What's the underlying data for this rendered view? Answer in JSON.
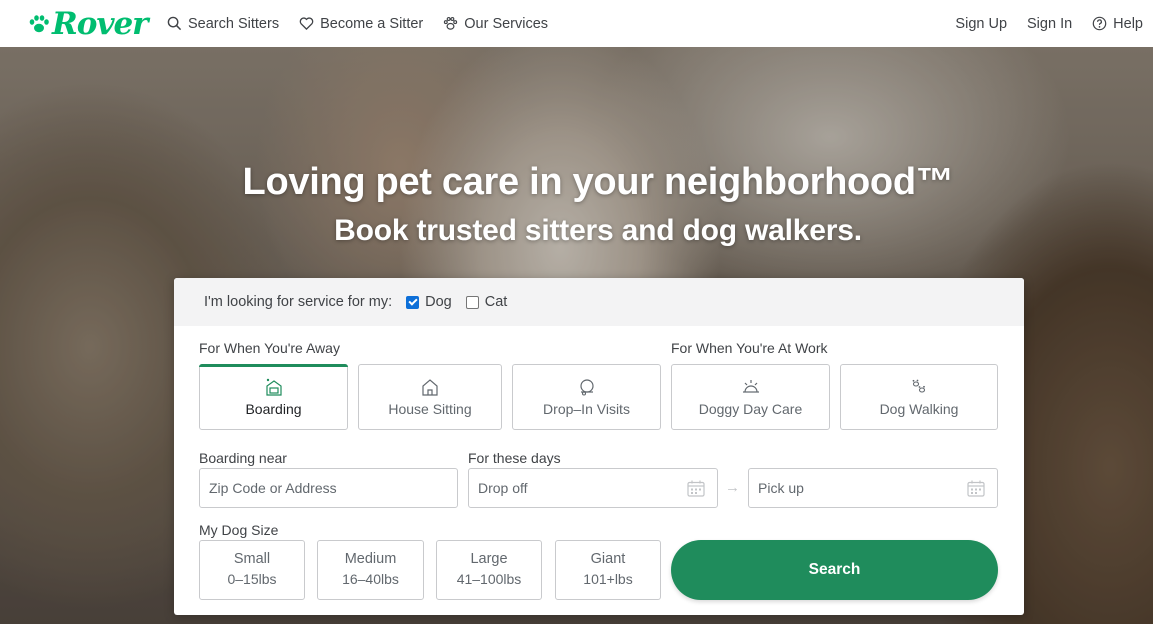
{
  "brand": {
    "name": "Rover",
    "color": "#00bd70",
    "accent": "#1f8c5c"
  },
  "nav": {
    "left": [
      {
        "label": "Search Sitters",
        "icon": "search-icon"
      },
      {
        "label": "Become a Sitter",
        "icon": "heart-icon"
      },
      {
        "label": "Our Services",
        "icon": "paw-icon"
      }
    ],
    "right": [
      {
        "label": "Sign Up"
      },
      {
        "label": "Sign In"
      },
      {
        "label": "Help",
        "icon": "help-icon"
      }
    ]
  },
  "hero": {
    "title": "Loving pet care in your neighborhood™",
    "subtitle": "Book trusted sitters and dog walkers."
  },
  "search": {
    "pet_prompt": "I'm looking for service for my:",
    "pets": [
      {
        "label": "Dog",
        "checked": true
      },
      {
        "label": "Cat",
        "checked": false
      }
    ],
    "away_label": "For When You're Away",
    "work_label": "For When You're At Work",
    "services": [
      {
        "label": "Boarding",
        "icon": "boarding-icon",
        "active": true
      },
      {
        "label": "House Sitting",
        "icon": "house-sitting-icon",
        "active": false
      },
      {
        "label": "Drop–In Visits",
        "icon": "drop-in-icon",
        "active": false
      },
      {
        "label": "Doggy Day Care",
        "icon": "day-care-icon",
        "active": false
      },
      {
        "label": "Dog Walking",
        "icon": "dog-walking-icon",
        "active": false
      }
    ],
    "location_label": "Boarding near",
    "location_placeholder": "Zip Code or Address",
    "dates_label": "For these days",
    "dropoff_placeholder": "Drop off",
    "pickup_placeholder": "Pick up",
    "size_label": "My Dog Size",
    "sizes": [
      {
        "name": "Small",
        "weight": "0–15lbs"
      },
      {
        "name": "Medium",
        "weight": "16–40lbs"
      },
      {
        "name": "Large",
        "weight": "41–100lbs"
      },
      {
        "name": "Giant",
        "weight": "101+lbs"
      }
    ],
    "search_button": "Search"
  }
}
